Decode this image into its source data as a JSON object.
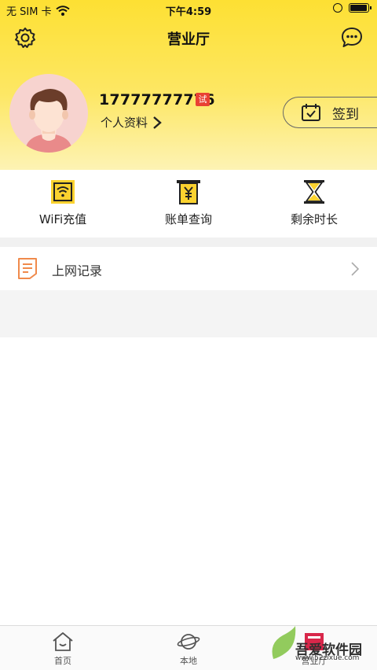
{
  "status_bar": {
    "carrier": "无 SIM 卡",
    "time": "下午4:59",
    "battery_level": 0.95
  },
  "nav": {
    "title": "营业厅",
    "left_icon": "gear-icon",
    "right_icon": "chat-bubble-icon"
  },
  "profile": {
    "phone": "17777777776",
    "badge": "试",
    "profile_link": "个人资料",
    "checkin_label": "签到"
  },
  "quick_actions": [
    {
      "label": "WiFi充值",
      "icon": "wifi-card-icon"
    },
    {
      "label": "账单查询",
      "icon": "yuan-bill-icon"
    },
    {
      "label": "剩余时长",
      "icon": "hourglass-icon"
    }
  ],
  "records": {
    "label": "上网记录",
    "icon": "document-lines-icon"
  },
  "tabs": [
    {
      "label": "首页",
      "icon": "home-icon"
    },
    {
      "label": "本地",
      "icon": "planet-icon"
    },
    {
      "label": "营业厅",
      "icon": "store-icon"
    }
  ],
  "watermark": {
    "title": "吾爱软件园",
    "url": "www.52zixue.com"
  },
  "colors": {
    "accent": "#fde033",
    "badge": "#e94133",
    "records_icon": "#f08a4b"
  }
}
